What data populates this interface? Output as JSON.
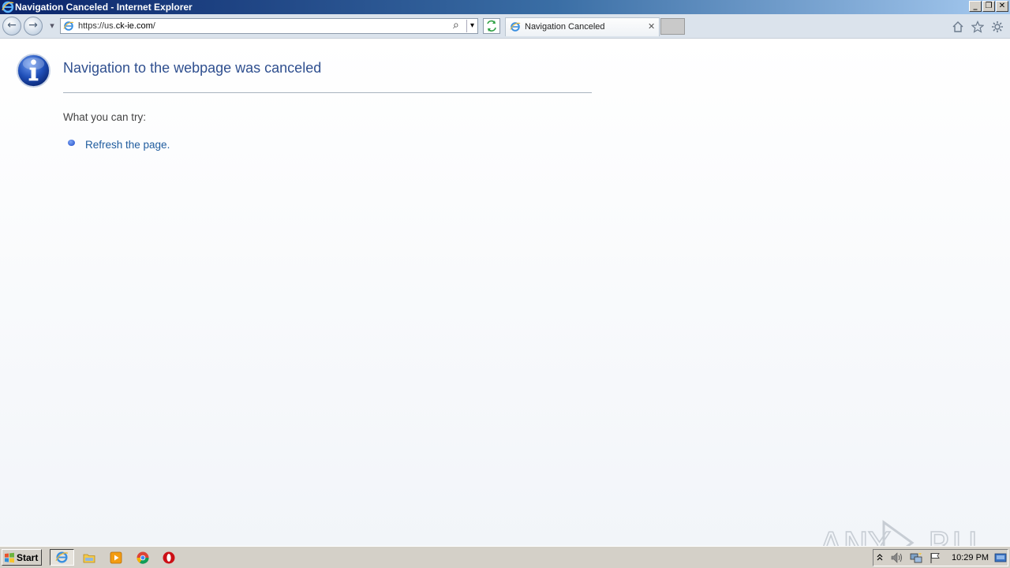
{
  "window": {
    "title": "Navigation Canceled - Internet Explorer",
    "minimize": "_",
    "restore": "❐",
    "close": "✕"
  },
  "navbar": {
    "back": "←",
    "forward": "→",
    "dropdown": "▾",
    "address_prefix": "https://us.",
    "address_domain": "ck-ie.com",
    "address_suffix": "/",
    "search_glyph": "⌕",
    "tab_label": "Navigation Canceled",
    "tab_close": "✕"
  },
  "content": {
    "heading": "Navigation to the webpage was canceled",
    "try_label": "What you can try:",
    "refresh_link": "Refresh the page.",
    "watermark": "ANY RUN"
  },
  "taskbar": {
    "start_label": "Start",
    "clock": "10:29 PM"
  },
  "colors": {
    "heading": "#2f4f8f",
    "link": "#1f5c9e",
    "titlebar": "#0a246a"
  }
}
